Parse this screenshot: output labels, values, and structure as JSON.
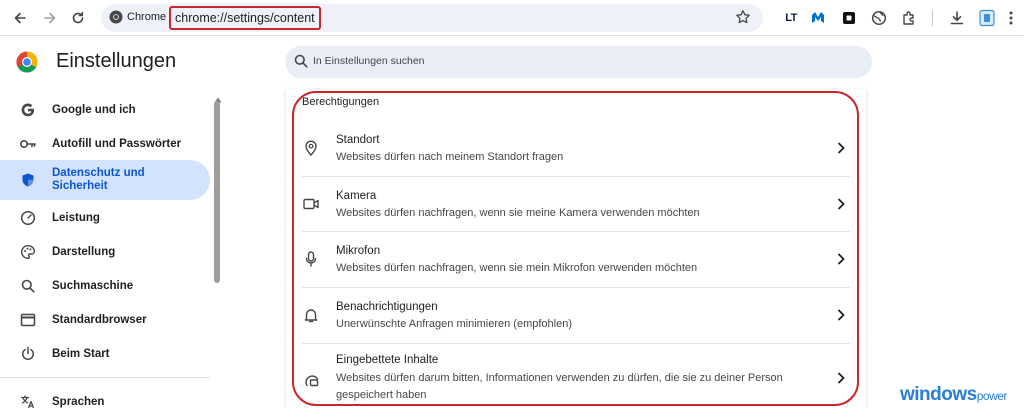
{
  "browser": {
    "chip_label": "Chrome",
    "url": "chrome://settings/content",
    "extensions": [
      {
        "label": "LT",
        "color": "#0d1b4c"
      },
      {
        "label": "M",
        "color": "#0071ce"
      },
      {
        "label": "",
        "color": "#111111"
      }
    ]
  },
  "header": {
    "title": "Einstellungen",
    "search_placeholder": "In Einstellungen suchen"
  },
  "sidebar": {
    "items": [
      {
        "label": "Google und ich",
        "icon": "google-g-icon"
      },
      {
        "label": "Autofill und Passwörter",
        "icon": "key-icon"
      },
      {
        "label": "Datenschutz und Sicherheit",
        "icon": "shield-icon",
        "active": true
      },
      {
        "label": "Leistung",
        "icon": "speedometer-icon"
      },
      {
        "label": "Darstellung",
        "icon": "palette-icon"
      },
      {
        "label": "Suchmaschine",
        "icon": "search-icon"
      },
      {
        "label": "Standardbrowser",
        "icon": "browser-window-icon"
      },
      {
        "label": "Beim Start",
        "icon": "power-icon"
      },
      {
        "label": "Sprachen",
        "icon": "translate-icon"
      }
    ]
  },
  "content": {
    "section_title": "Berechtigungen",
    "rows": [
      {
        "title": "Standort",
        "subtitle": "Websites dürfen nach meinem Standort fragen",
        "icon": "location-pin-icon"
      },
      {
        "title": "Kamera",
        "subtitle": "Websites dürfen nachfragen, wenn sie meine Kamera verwenden möchten",
        "icon": "camera-icon"
      },
      {
        "title": "Mikrofon",
        "subtitle": "Websites dürfen nachfragen, wenn sie mein Mikrofon verwenden möchten",
        "icon": "microphone-icon"
      },
      {
        "title": "Benachrichtigungen",
        "subtitle": "Unerwünschte Anfragen minimieren (empfohlen)",
        "icon": "bell-icon"
      },
      {
        "title": "Eingebettete Inhalte",
        "subtitle": "Websites dürfen darum bitten, Informationen verwenden zu dürfen, die sie zu deiner Person gespeichert haben",
        "icon": "embedded-content-icon"
      }
    ]
  },
  "watermark": {
    "main": "windows",
    "suffix": "power"
  },
  "colors": {
    "accent": "#0b57d0",
    "active_bg": "#d3e3fd",
    "annotation": "#c9282d"
  }
}
